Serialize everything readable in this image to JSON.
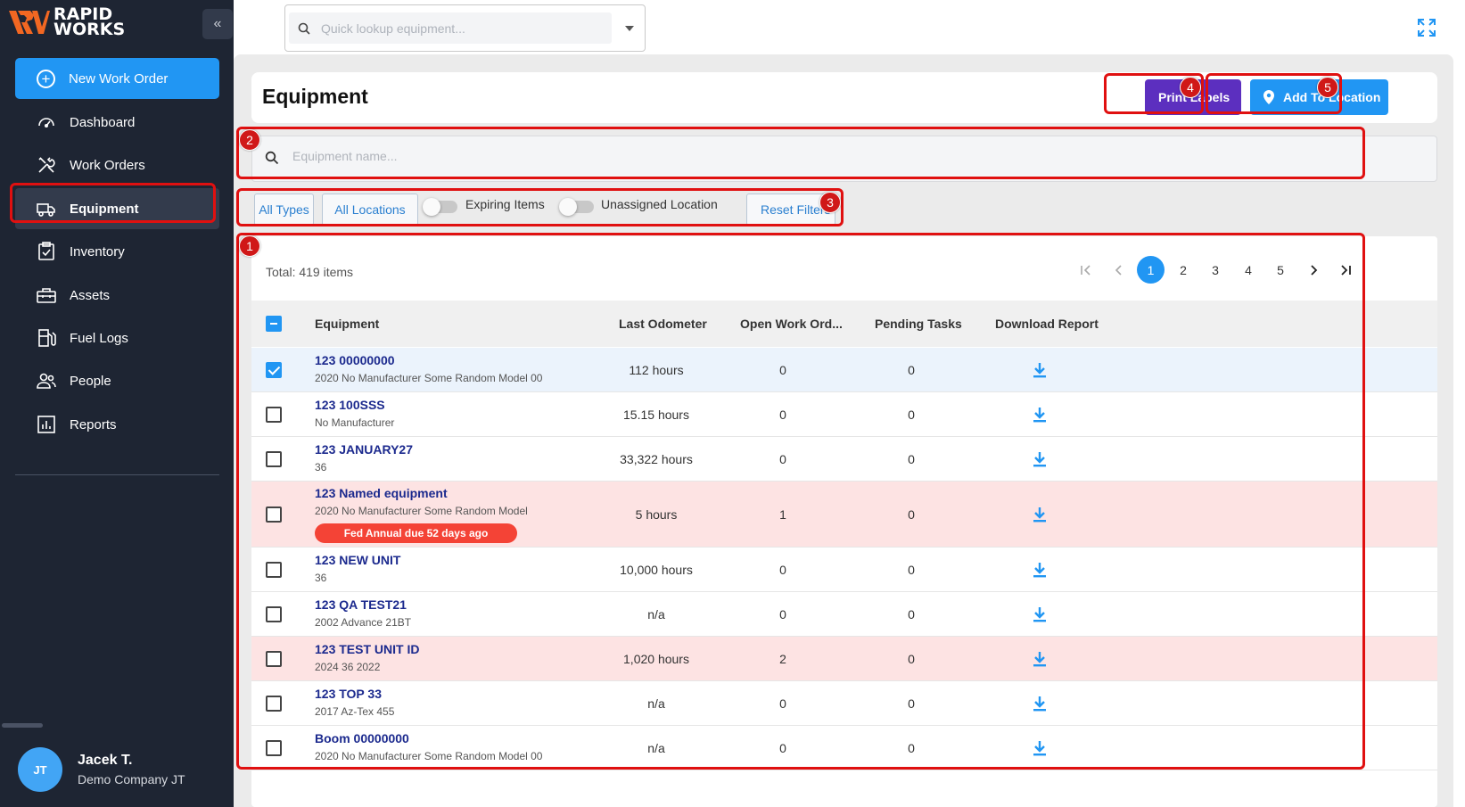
{
  "brand": {
    "line1": "RAPID",
    "line2": "WORKS",
    "logo_icon": "rapidworks-logo-icon"
  },
  "sidebar": {
    "collapse_label": "«",
    "new_work_order": "New Work Order",
    "items": [
      {
        "label": "Dashboard",
        "icon": "gauge-icon"
      },
      {
        "label": "Work Orders",
        "icon": "tools-icon"
      },
      {
        "label": "Equipment",
        "icon": "truck-icon"
      },
      {
        "label": "Inventory",
        "icon": "clipboard-check-icon"
      },
      {
        "label": "Assets",
        "icon": "toolbox-icon"
      },
      {
        "label": "Fuel Logs",
        "icon": "fuel-pump-icon"
      },
      {
        "label": "People",
        "icon": "people-icon"
      },
      {
        "label": "Reports",
        "icon": "bar-chart-icon"
      }
    ],
    "active": "Equipment"
  },
  "user": {
    "initials": "JT",
    "name": "Jacek T.",
    "company": "Demo Company JT"
  },
  "topbar": {
    "lookup_placeholder": "Quick lookup equipment..."
  },
  "page": {
    "title": "Equipment",
    "print_labels": "Print Labels",
    "add_to_location": "Add To Location",
    "search_placeholder": "Equipment name..."
  },
  "filters": {
    "all_types": "All Types",
    "all_locations": "All Locations",
    "expiring_items": "Expiring Items",
    "expiring_on": false,
    "unassigned_location": "Unassigned Location",
    "unassigned_on": false,
    "reset": "Reset Filters"
  },
  "table": {
    "total": "Total: 419 items",
    "pages": [
      "1",
      "2",
      "3",
      "4",
      "5"
    ],
    "current_page": "1",
    "pager_icons": [
      "first-page-icon",
      "prev-page-icon",
      "next-page-icon",
      "last-page-icon"
    ],
    "columns": [
      "Equipment",
      "Last Odometer",
      "Open Work Ord...",
      "Pending Tasks",
      "Download Report"
    ],
    "rows": [
      {
        "name": "123 00000000",
        "sub": "2020 No Manufacturer Some Random Model 00",
        "odometer": "112 hours",
        "open_wo": "0",
        "pending": "0",
        "checked": true,
        "highlight": false,
        "badge": null
      },
      {
        "name": "123 100SSS",
        "sub": "No Manufacturer",
        "odometer": "15.15 hours",
        "open_wo": "0",
        "pending": "0",
        "checked": false,
        "highlight": false,
        "badge": null
      },
      {
        "name": "123 JANUARY27",
        "sub": "36",
        "odometer": "33,322 hours",
        "open_wo": "0",
        "pending": "0",
        "checked": false,
        "highlight": false,
        "badge": null
      },
      {
        "name": "123 Named equipment",
        "sub": "2020 No Manufacturer Some Random Model",
        "odometer": "5 hours",
        "open_wo": "1",
        "pending": "0",
        "checked": false,
        "highlight": true,
        "badge": "Fed Annual due 52 days ago"
      },
      {
        "name": "123 NEW UNIT",
        "sub": "36",
        "odometer": "10,000 hours",
        "open_wo": "0",
        "pending": "0",
        "checked": false,
        "highlight": false,
        "badge": null
      },
      {
        "name": "123 QA TEST21",
        "sub": "2002 Advance 21BT",
        "odometer": "n/a",
        "open_wo": "0",
        "pending": "0",
        "checked": false,
        "highlight": false,
        "badge": null
      },
      {
        "name": "123 TEST UNIT ID",
        "sub": "2024 36 2022",
        "odometer": "1,020 hours",
        "open_wo": "2",
        "pending": "0",
        "checked": false,
        "highlight": true,
        "badge": null
      },
      {
        "name": "123 TOP 33",
        "sub": "2017 Az-Tex 455",
        "odometer": "n/a",
        "open_wo": "0",
        "pending": "0",
        "checked": false,
        "highlight": false,
        "badge": null
      },
      {
        "name": "Boom 00000000",
        "sub": "2020 No Manufacturer Some Random Model 00",
        "odometer": "n/a",
        "open_wo": "0",
        "pending": "0",
        "checked": false,
        "highlight": false,
        "badge": null
      }
    ]
  },
  "markers": [
    "1",
    "2",
    "3",
    "4",
    "5"
  ],
  "colors": {
    "accent": "#2196f3",
    "purple": "#5c2fbf",
    "sidebar": "#1e2533",
    "danger": "#f44336",
    "annotation": "#e01010",
    "link": "#1c2a8e"
  }
}
